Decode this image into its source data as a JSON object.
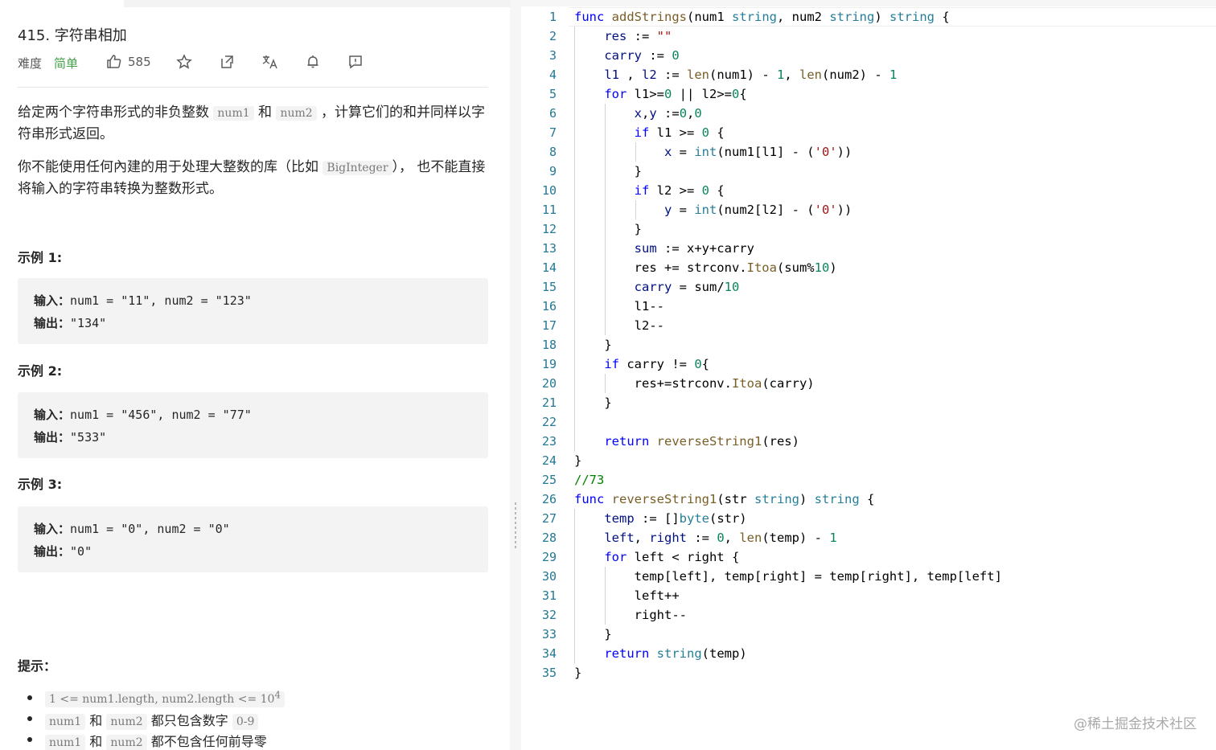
{
  "problem": {
    "title": "415. 字符串相加",
    "difficulty_label": "难度",
    "difficulty_value": "简单",
    "likes": "585",
    "description": {
      "p1_a": "给定两个字符串形式的非负整数 ",
      "p1_code1": "num1",
      "p1_b": " 和",
      "p1_code2": "num2",
      "p1_c": " ，计算它们的和并同样以字符串形式返回。",
      "p2_a": "你不能使用任何內建的用于处理大整数的库（比如 ",
      "p2_code": "BigInteger",
      "p2_b": "）， 也不能直接将输入的字符串转换为整数形式。"
    },
    "examples": [
      {
        "title": "示例 1:",
        "input_label": "输入：",
        "input": "num1 = \"11\", num2 = \"123\"",
        "output_label": "输出：",
        "output": "\"134\""
      },
      {
        "title": "示例 2:",
        "input_label": "输入：",
        "input": "num1 = \"456\", num2 = \"77\"",
        "output_label": "输出：",
        "output": "\"533\""
      },
      {
        "title": "示例 3:",
        "input_label": "输入：",
        "input": "num1 = \"0\", num2 = \"0\"",
        "output_label": "输出：",
        "output": "\"0\""
      }
    ],
    "hints_title": "提示：",
    "hints": {
      "h1_code": "1 <= num1.length, num2.length <= 10",
      "h1_sup": "4",
      "h2_code1": "num1",
      "h2_mid": " 和 ",
      "h2_code2": "num2",
      "h2_text": " 都只包含数字 ",
      "h2_code3": "0-9",
      "h3_code1": "num1",
      "h3_mid": " 和 ",
      "h3_code2": "num2",
      "h3_text": " 都不包含任何前导零"
    },
    "toolbar_icons": [
      "thumbs-up-icon",
      "star-icon",
      "share-icon",
      "translate-icon",
      "bell-icon",
      "feedback-icon"
    ]
  },
  "editor": {
    "lines": [
      {
        "n": "1",
        "indent": 0,
        "tokens": [
          [
            "kw",
            "func "
          ],
          [
            "fn",
            "addStrings"
          ],
          [
            "",
            "(num1 "
          ],
          [
            "ty",
            "string"
          ],
          [
            "",
            ", num2 "
          ],
          [
            "ty",
            "string"
          ],
          [
            "",
            ") "
          ],
          [
            "ty",
            "string"
          ],
          [
            "",
            " {"
          ]
        ]
      },
      {
        "n": "2",
        "indent": 1,
        "tokens": [
          [
            "var",
            "res"
          ],
          [
            "",
            " := "
          ],
          [
            "str",
            "\"\""
          ]
        ]
      },
      {
        "n": "3",
        "indent": 1,
        "tokens": [
          [
            "var",
            "carry"
          ],
          [
            "",
            " := "
          ],
          [
            "num",
            "0"
          ]
        ]
      },
      {
        "n": "4",
        "indent": 1,
        "tokens": [
          [
            "var",
            "l1"
          ],
          [
            "",
            " , "
          ],
          [
            "var",
            "l2"
          ],
          [
            "",
            " := "
          ],
          [
            "fn",
            "len"
          ],
          [
            "",
            "(num1) - "
          ],
          [
            "num",
            "1"
          ],
          [
            "",
            ", "
          ],
          [
            "fn",
            "len"
          ],
          [
            "",
            "(num2) - "
          ],
          [
            "num",
            "1"
          ]
        ]
      },
      {
        "n": "5",
        "indent": 1,
        "tokens": [
          [
            "kw",
            "for"
          ],
          [
            "",
            " l1>="
          ],
          [
            "num",
            "0"
          ],
          [
            "",
            " || l2>="
          ],
          [
            "num",
            "0"
          ],
          [
            "",
            "{"
          ]
        ]
      },
      {
        "n": "6",
        "indent": 2,
        "tokens": [
          [
            "var",
            "x"
          ],
          [
            "",
            ","
          ],
          [
            "var",
            "y"
          ],
          [
            "",
            " :="
          ],
          [
            "num",
            "0"
          ],
          [
            "",
            ","
          ],
          [
            "num",
            "0"
          ]
        ]
      },
      {
        "n": "7",
        "indent": 2,
        "tokens": [
          [
            "kw",
            "if"
          ],
          [
            "",
            " l1 >= "
          ],
          [
            "num",
            "0"
          ],
          [
            "",
            " {"
          ]
        ]
      },
      {
        "n": "8",
        "indent": 3,
        "tokens": [
          [
            "var",
            "x"
          ],
          [
            "",
            " = "
          ],
          [
            "ty",
            "int"
          ],
          [
            "",
            "(num1[l1] - ("
          ],
          [
            "str",
            "'0'"
          ],
          [
            "",
            "))"
          ]
        ]
      },
      {
        "n": "9",
        "indent": 2,
        "tokens": [
          [
            "",
            "}"
          ]
        ]
      },
      {
        "n": "10",
        "indent": 2,
        "tokens": [
          [
            "kw",
            "if"
          ],
          [
            "",
            " l2 >= "
          ],
          [
            "num",
            "0"
          ],
          [
            "",
            " {"
          ]
        ]
      },
      {
        "n": "11",
        "indent": 3,
        "tokens": [
          [
            "var",
            "y"
          ],
          [
            "",
            " = "
          ],
          [
            "ty",
            "int"
          ],
          [
            "",
            "(num2[l2] - ("
          ],
          [
            "str",
            "'0'"
          ],
          [
            "",
            "))"
          ]
        ]
      },
      {
        "n": "12",
        "indent": 2,
        "tokens": [
          [
            "",
            "}"
          ]
        ]
      },
      {
        "n": "13",
        "indent": 2,
        "tokens": [
          [
            "var",
            "sum"
          ],
          [
            "",
            " := x+y+carry"
          ]
        ]
      },
      {
        "n": "14",
        "indent": 2,
        "tokens": [
          [
            "",
            "res += strconv."
          ],
          [
            "fn",
            "Itoa"
          ],
          [
            "",
            "(sum%"
          ],
          [
            "num",
            "10"
          ],
          [
            "",
            ")"
          ]
        ]
      },
      {
        "n": "15",
        "indent": 2,
        "tokens": [
          [
            "var",
            "carry"
          ],
          [
            "",
            " = sum/"
          ],
          [
            "num",
            "10"
          ]
        ]
      },
      {
        "n": "16",
        "indent": 2,
        "tokens": [
          [
            "",
            "l1--"
          ]
        ]
      },
      {
        "n": "17",
        "indent": 2,
        "tokens": [
          [
            "",
            "l2--"
          ]
        ]
      },
      {
        "n": "18",
        "indent": 1,
        "tokens": [
          [
            "",
            "}"
          ]
        ]
      },
      {
        "n": "19",
        "indent": 1,
        "tokens": [
          [
            "kw",
            "if"
          ],
          [
            "",
            " carry != "
          ],
          [
            "num",
            "0"
          ],
          [
            "",
            "{"
          ]
        ]
      },
      {
        "n": "20",
        "indent": 2,
        "tokens": [
          [
            "",
            "res+=strconv."
          ],
          [
            "fn",
            "Itoa"
          ],
          [
            "",
            "(carry)"
          ]
        ]
      },
      {
        "n": "21",
        "indent": 1,
        "tokens": [
          [
            "",
            "}"
          ]
        ]
      },
      {
        "n": "22",
        "indent": 1,
        "tokens": []
      },
      {
        "n": "23",
        "indent": 1,
        "tokens": [
          [
            "kw",
            "return "
          ],
          [
            "fn",
            "reverseString1"
          ],
          [
            "",
            "(res)"
          ]
        ]
      },
      {
        "n": "24",
        "indent": 0,
        "tokens": [
          [
            "",
            "}"
          ]
        ]
      },
      {
        "n": "25",
        "indent": 0,
        "tokens": [
          [
            "cm",
            "//73"
          ]
        ]
      },
      {
        "n": "26",
        "indent": 0,
        "tokens": [
          [
            "kw",
            "func "
          ],
          [
            "fn",
            "reverseString1"
          ],
          [
            "",
            "(str "
          ],
          [
            "ty",
            "string"
          ],
          [
            "",
            ") "
          ],
          [
            "ty",
            "string"
          ],
          [
            "",
            " {"
          ]
        ]
      },
      {
        "n": "27",
        "indent": 1,
        "tokens": [
          [
            "var",
            "temp"
          ],
          [
            "",
            " := []"
          ],
          [
            "ty",
            "byte"
          ],
          [
            "",
            "(str)"
          ]
        ]
      },
      {
        "n": "28",
        "indent": 1,
        "tokens": [
          [
            "var",
            "left"
          ],
          [
            "",
            ", "
          ],
          [
            "var",
            "right"
          ],
          [
            "",
            " := "
          ],
          [
            "num",
            "0"
          ],
          [
            "",
            ", "
          ],
          [
            "fn",
            "len"
          ],
          [
            "",
            "(temp) - "
          ],
          [
            "num",
            "1"
          ]
        ]
      },
      {
        "n": "29",
        "indent": 1,
        "tokens": [
          [
            "kw",
            "for"
          ],
          [
            "",
            " left < right {"
          ]
        ]
      },
      {
        "n": "30",
        "indent": 2,
        "tokens": [
          [
            "",
            "temp[left], temp[right] = temp[right], temp[left]"
          ]
        ]
      },
      {
        "n": "31",
        "indent": 2,
        "tokens": [
          [
            "",
            "left++"
          ]
        ]
      },
      {
        "n": "32",
        "indent": 2,
        "tokens": [
          [
            "",
            "right--"
          ]
        ]
      },
      {
        "n": "33",
        "indent": 1,
        "tokens": [
          [
            "",
            "}"
          ]
        ]
      },
      {
        "n": "34",
        "indent": 1,
        "tokens": [
          [
            "kw",
            "return "
          ],
          [
            "ty",
            "string"
          ],
          [
            "",
            "(temp)"
          ]
        ]
      },
      {
        "n": "35",
        "indent": 0,
        "tokens": [
          [
            "",
            "}"
          ]
        ]
      }
    ]
  },
  "watermark": "@稀土掘金技术社区"
}
